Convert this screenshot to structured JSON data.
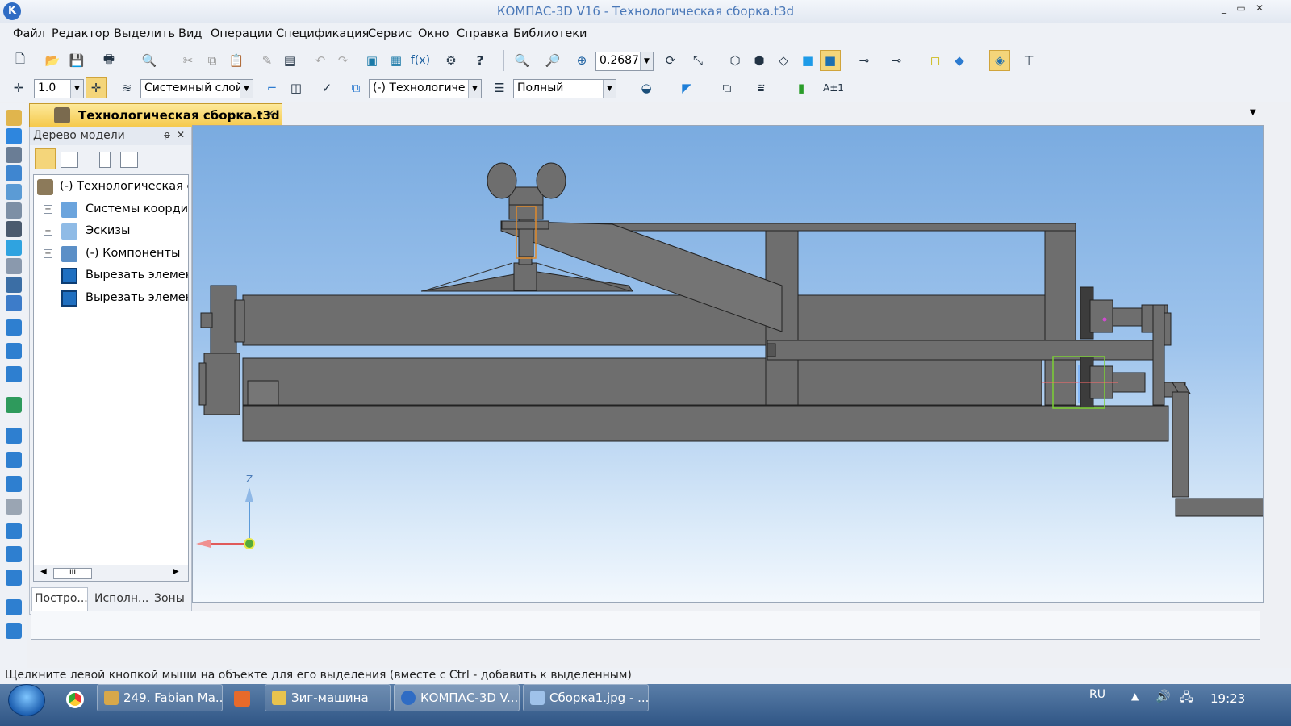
{
  "window": {
    "title": "КОМПАС-3D V16  - Технологическая сборка.t3d",
    "logo": "K",
    "controls": [
      "_",
      "▭",
      "✕"
    ]
  },
  "menu": [
    "Файл",
    "Редактор",
    "Выделить",
    "Вид",
    "Операции",
    "Спецификация",
    "Сервис",
    "Окно",
    "Справка",
    "Библиотеки"
  ],
  "toolbar1": {
    "zoom_value": "0.2687"
  },
  "toolbar2": {
    "step_value": "1.0",
    "layer_value": "Системный слой",
    "config_value": "(-) Технологиче",
    "mode_value": "Полный"
  },
  "document_tab": {
    "label": "Технологическая сборка.t3d",
    "close": "×"
  },
  "tree_panel": {
    "title": "Дерево модели",
    "pin": "ᵽ",
    "close": "✕",
    "items": [
      {
        "label": "(-) Технологическая с",
        "expander": ""
      },
      {
        "label": "Системы коорди",
        "expander": "+"
      },
      {
        "label": "Эскизы",
        "expander": "+"
      },
      {
        "label": "(-) Компоненты",
        "expander": "+"
      },
      {
        "label": "Вырезать элемен",
        "expander": ""
      },
      {
        "label": "Вырезать элемен",
        "expander": ""
      }
    ],
    "scroll_thumb": "III",
    "tabs": [
      "Постро...",
      "Исполн...",
      "Зоны"
    ]
  },
  "viewport": {
    "axis_label": "Z"
  },
  "statusbar": {
    "text": "Щелкните левой кнопкой мыши на объекте для его выделения (вместе с Ctrl - добавить к выделенным)"
  },
  "taskbar": {
    "tasks": [
      "249. Fabian Ma...",
      "Зиг-машина",
      "КОМПАС-3D V...",
      "Сборка1.jpg - ..."
    ],
    "lang": "RU",
    "clock": "19:23"
  },
  "colors": {
    "title_text": "#4a78b8",
    "tab_active": "#f5c94c",
    "model_grey": "#6d6d6d",
    "viewport_top": "#7aabe0"
  }
}
